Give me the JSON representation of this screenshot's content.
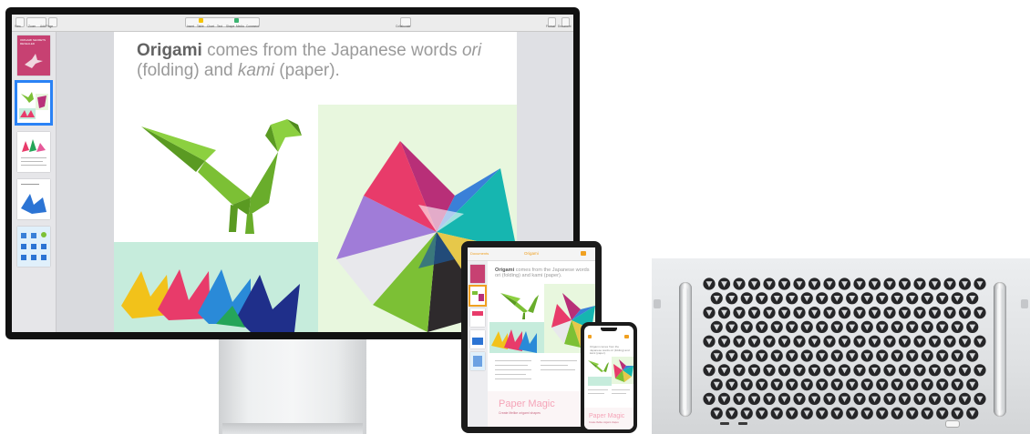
{
  "display": {
    "toolbar": {
      "left_labels": [
        "View",
        "Zoom",
        "Add Page"
      ],
      "center_labels": [
        "Insert",
        "Table",
        "Chart",
        "Text",
        "Shape",
        "Media",
        "Comment"
      ],
      "collaborate_label": "Collaborate",
      "right_labels": [
        "Format",
        "Document"
      ]
    },
    "sidebar": {
      "cover_title": "ORIGAMI SECRETS REVEALED"
    },
    "document": {
      "headline_bold": "Origami",
      "headline_part1": " comes from the Japanese words ",
      "headline_italic1": "ori",
      "headline_part2": " (folding) and ",
      "headline_italic2": "kami",
      "headline_part3": " (paper)."
    }
  },
  "ipad": {
    "nav_label": "Documents",
    "title": "Origami",
    "headline_bold": "Origami",
    "headline_rest": " comes from the Japanese words ori (folding) and kami (paper).",
    "footer_title": "Paper Magic",
    "footer_subtitle": "Create lifelike origami shapes"
  },
  "iphone": {
    "headline": "Origami comes from the Japanese words ori (folding) and kami (paper).",
    "footer_title": "Paper Magic",
    "footer_subtitle": "Create lifelike origami shapes"
  },
  "colors": {
    "accent": "#2a82f5",
    "pink": "#f5a4b8",
    "dino_green": "#7cc035",
    "green_panel": "#e8f7de",
    "mint_panel": "#c6ecdc"
  }
}
